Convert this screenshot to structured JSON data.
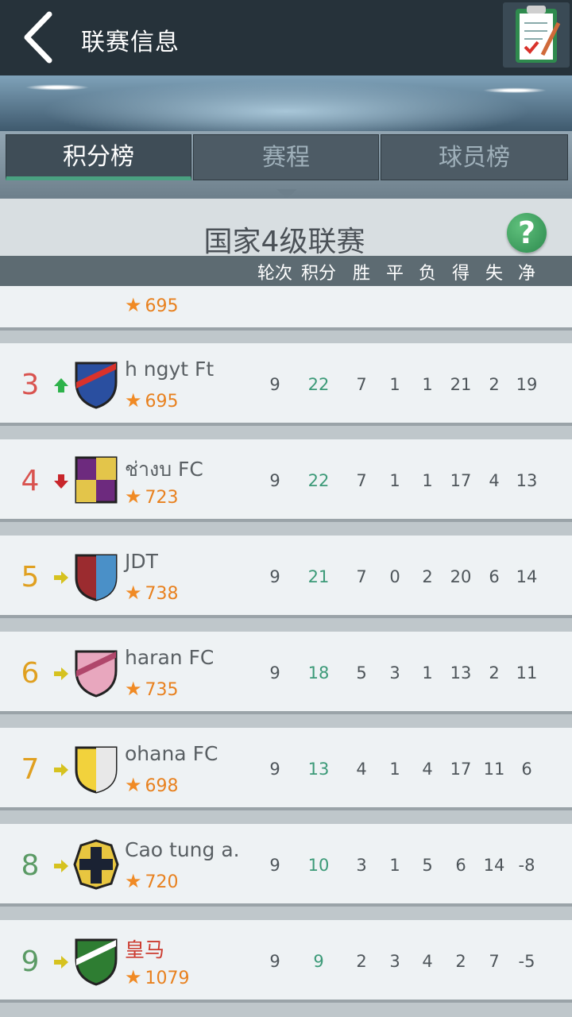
{
  "header": {
    "title": "联赛信息",
    "back_icon": "chevron-left-icon",
    "clipboard_icon": "clipboard-checklist-icon"
  },
  "tabs": [
    {
      "label": "积分榜",
      "active": true
    },
    {
      "label": "赛程",
      "active": false
    },
    {
      "label": "球员榜",
      "active": false
    }
  ],
  "league": {
    "name": "国家4级联赛",
    "help_label": "?"
  },
  "columns": [
    "轮次",
    "积分",
    "胜",
    "平",
    "负",
    "得",
    "失",
    "净"
  ],
  "partial_row": {
    "rating": "695"
  },
  "rows": [
    {
      "rank": "3",
      "trend": "up",
      "name": "h    ngyt Ft",
      "rating": "695",
      "played": "9",
      "points": "22",
      "won": "7",
      "drawn": "1",
      "lost": "1",
      "gf": "21",
      "ga": "2",
      "gd": "19",
      "rank_color": "#d9534f",
      "badge": {
        "shape": "shield",
        "c1": "#2a4fa0",
        "c2": "#111111",
        "stripe": "#d9322b"
      }
    },
    {
      "rank": "4",
      "trend": "down",
      "name": "ช่างบ FC",
      "rating": "723",
      "played": "9",
      "points": "22",
      "won": "7",
      "drawn": "1",
      "lost": "1",
      "gf": "17",
      "ga": "4",
      "gd": "13",
      "rank_color": "#d9534f",
      "badge": {
        "shape": "square",
        "c1": "#6d2a7e",
        "c2": "#e3c54a"
      }
    },
    {
      "rank": "5",
      "trend": "same",
      "name": "JDT",
      "rating": "738",
      "played": "9",
      "points": "21",
      "won": "7",
      "drawn": "0",
      "lost": "2",
      "gf": "20",
      "ga": "6",
      "gd": "14",
      "rank_color": "#e0a020",
      "badge": {
        "shape": "round",
        "c1": "#9b2b2f",
        "c2": "#4a90c8"
      }
    },
    {
      "rank": "6",
      "trend": "same",
      "name": "haran FC",
      "rating": "735",
      "played": "9",
      "points": "18",
      "won": "5",
      "drawn": "3",
      "lost": "1",
      "gf": "13",
      "ga": "2",
      "gd": "11",
      "rank_color": "#e0a020",
      "badge": {
        "shape": "shield",
        "c1": "#e8a7be",
        "c2": "#ffffff",
        "stripe": "#b0476b"
      }
    },
    {
      "rank": "7",
      "trend": "same",
      "name": "ohana FC",
      "rating": "698",
      "played": "9",
      "points": "13",
      "won": "4",
      "drawn": "1",
      "lost": "4",
      "gf": "17",
      "ga": "11",
      "gd": "6",
      "rank_color": "#e0a020",
      "badge": {
        "shape": "round",
        "c1": "#f2d23c",
        "c2": "#e8e8e8"
      }
    },
    {
      "rank": "8",
      "trend": "same",
      "name": "Cao tung a.",
      "rating": "720",
      "played": "9",
      "points": "10",
      "won": "3",
      "drawn": "1",
      "lost": "5",
      "gf": "6",
      "ga": "14",
      "gd": "-8",
      "rank_color": "#5a9a64",
      "badge": {
        "shape": "crest",
        "c1": "#e8c640",
        "c2": "#1a2233"
      }
    },
    {
      "rank": "9",
      "trend": "same",
      "name": "皇马",
      "rating": "1079",
      "played": "9",
      "points": "9",
      "won": "2",
      "drawn": "3",
      "lost": "4",
      "gf": "2",
      "ga": "7",
      "gd": "-5",
      "rank_color": "#5a9a64",
      "name_color": "#cc3b2f",
      "badge": {
        "shape": "shield",
        "c1": "#2e7d32",
        "c2": "#1a1a1a",
        "stripe": "#ffffff"
      }
    }
  ]
}
